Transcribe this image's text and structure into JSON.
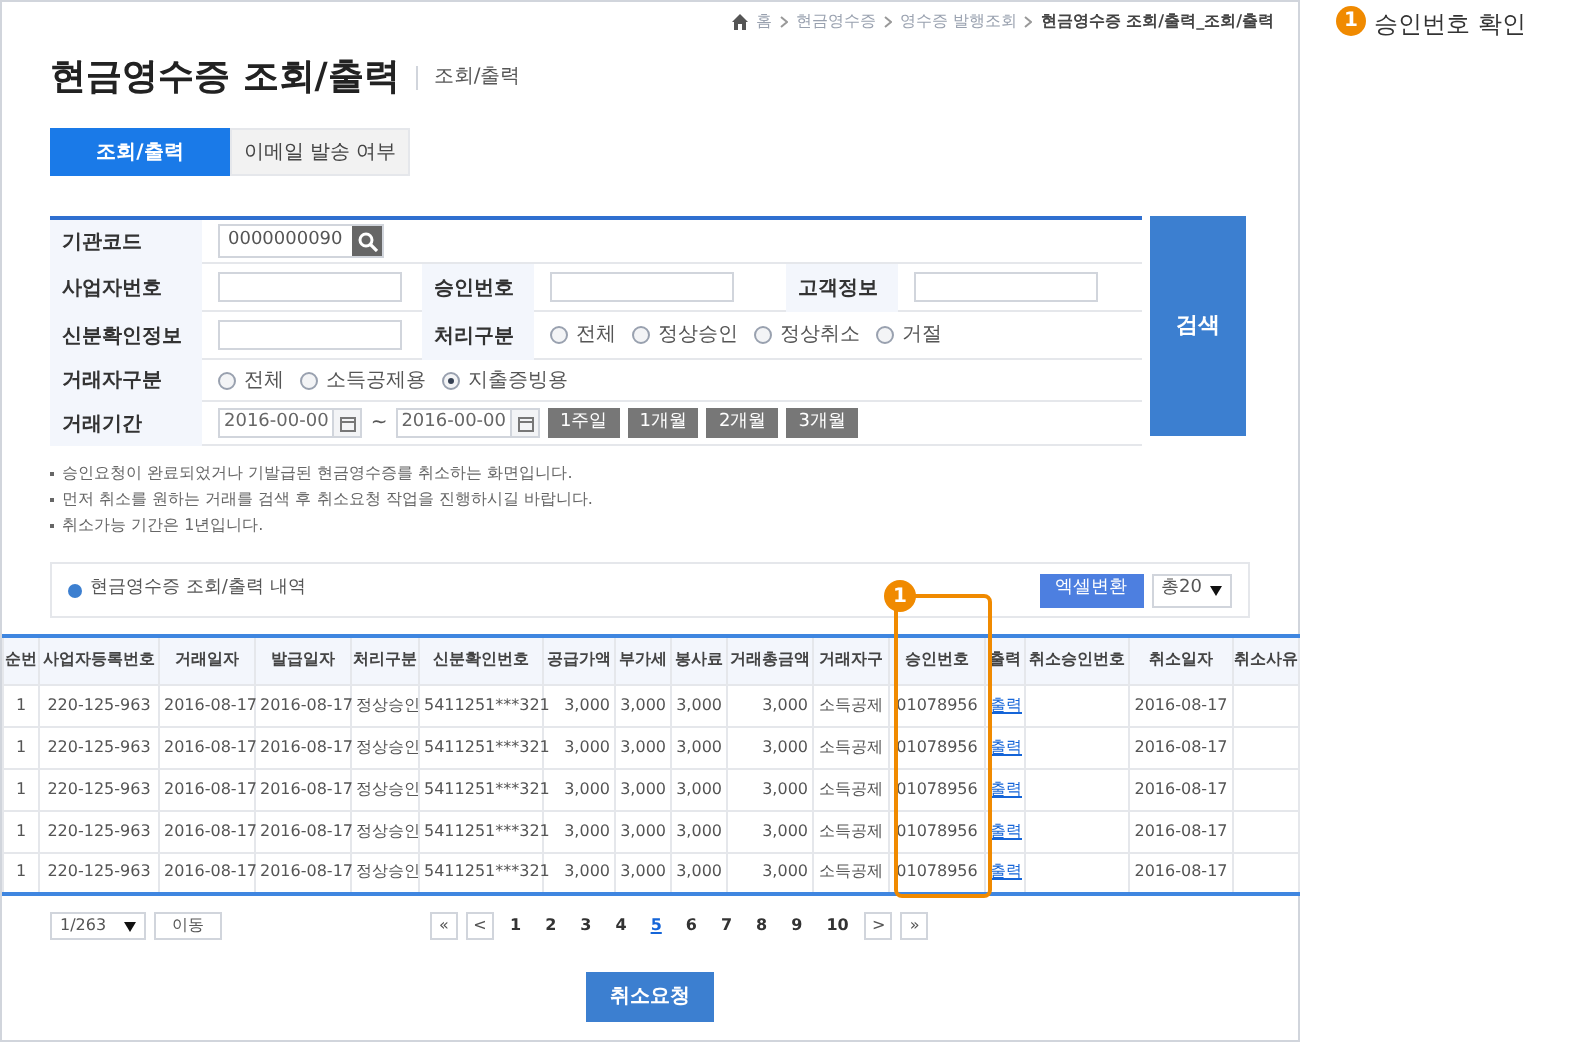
{
  "breadcrumb": [
    "홈",
    "현금영수증",
    "영수증 발행조회",
    "현금영수증 조회/출력_조회/출력"
  ],
  "title": "현금영수증 조회/출력",
  "subtitle": "조회/출력",
  "tabs": [
    {
      "label": "조회/출력",
      "selected": true
    },
    {
      "label": "이메일 발송 여부",
      "selected": false
    }
  ],
  "form": {
    "agency_code": {
      "label": "기관코드",
      "value": "0000000090"
    },
    "business_no": {
      "label": "사업자번호"
    },
    "approval_no": {
      "label": "승인번호"
    },
    "customer_info": {
      "label": "고객정보"
    },
    "id_info": {
      "label": "신분확인정보"
    },
    "process_type": {
      "label": "처리구분",
      "options": [
        {
          "label": "전체",
          "selected": false
        },
        {
          "label": "정상승인",
          "selected": false
        },
        {
          "label": "정상취소",
          "selected": false
        },
        {
          "label": "거절",
          "selected": false
        }
      ]
    },
    "trader_type": {
      "label": "거래자구분",
      "options": [
        {
          "label": "전체",
          "selected": false
        },
        {
          "label": "소득공제용",
          "selected": false
        },
        {
          "label": "지출증빙용",
          "selected": true
        }
      ]
    },
    "period": {
      "label": "거래기간",
      "from": "2016-00-00",
      "separator": "~",
      "to": "2016-00-00",
      "buttons": [
        "1주일",
        "1개월",
        "2개월",
        "3개월"
      ]
    },
    "search_button": "검색"
  },
  "notes": [
    "승인요청이 완료되었거나 기발급된 현금영수증를 취소하는 화면입니다.",
    "먼저 취소를 원하는 거래를 검색 후 취소요청 작업을 진행하시길 바랍니다.",
    "취소가능 기간은 1년입니다."
  ],
  "section": {
    "title": "현금영수증 조회/출력 내역",
    "excel_button": "엑셀변환",
    "page_size": "총20"
  },
  "table": {
    "columns": [
      "순번",
      "사업자등록번호",
      "거래일자",
      "발급일자",
      "처리구분",
      "신분확인번호",
      "공급가액",
      "부가세",
      "봉사료",
      "거래총금액",
      "거래자구",
      "승인번호",
      "출력",
      "취소승인번호",
      "취소일자",
      "취소사유"
    ],
    "rows": [
      [
        "1",
        "220-125-963",
        "2016-08-17",
        "2016-08-17",
        "정상승인",
        "5411251***321",
        "3,000",
        "3,000",
        "3,000",
        "3,000",
        "소득공제",
        "01078956",
        "출력",
        "",
        "2016-08-17",
        ""
      ],
      [
        "1",
        "220-125-963",
        "2016-08-17",
        "2016-08-17",
        "정상승인",
        "5411251***321",
        "3,000",
        "3,000",
        "3,000",
        "3,000",
        "소득공제",
        "01078956",
        "출력",
        "",
        "2016-08-17",
        ""
      ],
      [
        "1",
        "220-125-963",
        "2016-08-17",
        "2016-08-17",
        "정상승인",
        "5411251***321",
        "3,000",
        "3,000",
        "3,000",
        "3,000",
        "소득공제",
        "01078956",
        "출력",
        "",
        "2016-08-17",
        ""
      ],
      [
        "1",
        "220-125-963",
        "2016-08-17",
        "2016-08-17",
        "정상승인",
        "5411251***321",
        "3,000",
        "3,000",
        "3,000",
        "3,000",
        "소득공제",
        "01078956",
        "출력",
        "",
        "2016-08-17",
        ""
      ],
      [
        "1",
        "220-125-963",
        "2016-08-17",
        "2016-08-17",
        "정상승인",
        "5411251***321",
        "3,000",
        "3,000",
        "3,000",
        "3,000",
        "소득공제",
        "01078956",
        "출력",
        "",
        "2016-08-17",
        ""
      ]
    ]
  },
  "pagination": {
    "page_select": "1/263",
    "go_button": "이동",
    "first": "«",
    "prev": "<",
    "pages": [
      {
        "label": "1",
        "selected": false
      },
      {
        "label": "2",
        "selected": false
      },
      {
        "label": "3",
        "selected": false
      },
      {
        "label": "4",
        "selected": false
      },
      {
        "label": "5",
        "selected": true
      },
      {
        "label": "6",
        "selected": false
      },
      {
        "label": "7",
        "selected": false
      },
      {
        "label": "8",
        "selected": false
      },
      {
        "label": "9",
        "selected": false
      },
      {
        "label": "10",
        "selected": false
      }
    ],
    "next": ">",
    "last": "»"
  },
  "cancel_button": "취소요청",
  "table_callout": {
    "number": "1"
  },
  "annotation": {
    "number": "1",
    "text": "승인번호 확인"
  }
}
